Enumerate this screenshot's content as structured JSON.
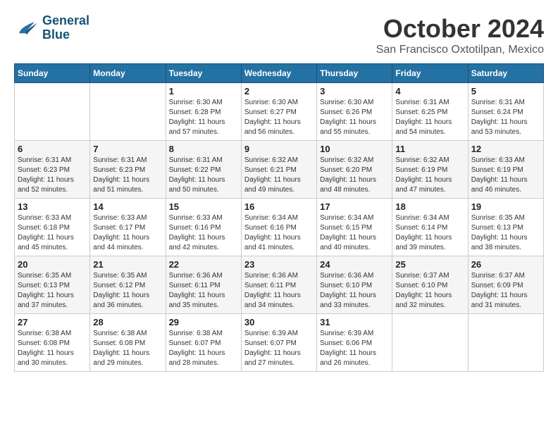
{
  "header": {
    "logo": {
      "line1": "General",
      "line2": "Blue"
    },
    "month": "October 2024",
    "location": "San Francisco Oxtotilpan, Mexico"
  },
  "days_of_week": [
    "Sunday",
    "Monday",
    "Tuesday",
    "Wednesday",
    "Thursday",
    "Friday",
    "Saturday"
  ],
  "weeks": [
    [
      {
        "day": "",
        "sunrise": "",
        "sunset": "",
        "daylight": ""
      },
      {
        "day": "",
        "sunrise": "",
        "sunset": "",
        "daylight": ""
      },
      {
        "day": "1",
        "sunrise": "Sunrise: 6:30 AM",
        "sunset": "Sunset: 6:28 PM",
        "daylight": "Daylight: 11 hours and 57 minutes."
      },
      {
        "day": "2",
        "sunrise": "Sunrise: 6:30 AM",
        "sunset": "Sunset: 6:27 PM",
        "daylight": "Daylight: 11 hours and 56 minutes."
      },
      {
        "day": "3",
        "sunrise": "Sunrise: 6:30 AM",
        "sunset": "Sunset: 6:26 PM",
        "daylight": "Daylight: 11 hours and 55 minutes."
      },
      {
        "day": "4",
        "sunrise": "Sunrise: 6:31 AM",
        "sunset": "Sunset: 6:25 PM",
        "daylight": "Daylight: 11 hours and 54 minutes."
      },
      {
        "day": "5",
        "sunrise": "Sunrise: 6:31 AM",
        "sunset": "Sunset: 6:24 PM",
        "daylight": "Daylight: 11 hours and 53 minutes."
      }
    ],
    [
      {
        "day": "6",
        "sunrise": "Sunrise: 6:31 AM",
        "sunset": "Sunset: 6:23 PM",
        "daylight": "Daylight: 11 hours and 52 minutes."
      },
      {
        "day": "7",
        "sunrise": "Sunrise: 6:31 AM",
        "sunset": "Sunset: 6:23 PM",
        "daylight": "Daylight: 11 hours and 51 minutes."
      },
      {
        "day": "8",
        "sunrise": "Sunrise: 6:31 AM",
        "sunset": "Sunset: 6:22 PM",
        "daylight": "Daylight: 11 hours and 50 minutes."
      },
      {
        "day": "9",
        "sunrise": "Sunrise: 6:32 AM",
        "sunset": "Sunset: 6:21 PM",
        "daylight": "Daylight: 11 hours and 49 minutes."
      },
      {
        "day": "10",
        "sunrise": "Sunrise: 6:32 AM",
        "sunset": "Sunset: 6:20 PM",
        "daylight": "Daylight: 11 hours and 48 minutes."
      },
      {
        "day": "11",
        "sunrise": "Sunrise: 6:32 AM",
        "sunset": "Sunset: 6:19 PM",
        "daylight": "Daylight: 11 hours and 47 minutes."
      },
      {
        "day": "12",
        "sunrise": "Sunrise: 6:33 AM",
        "sunset": "Sunset: 6:19 PM",
        "daylight": "Daylight: 11 hours and 46 minutes."
      }
    ],
    [
      {
        "day": "13",
        "sunrise": "Sunrise: 6:33 AM",
        "sunset": "Sunset: 6:18 PM",
        "daylight": "Daylight: 11 hours and 45 minutes."
      },
      {
        "day": "14",
        "sunrise": "Sunrise: 6:33 AM",
        "sunset": "Sunset: 6:17 PM",
        "daylight": "Daylight: 11 hours and 44 minutes."
      },
      {
        "day": "15",
        "sunrise": "Sunrise: 6:33 AM",
        "sunset": "Sunset: 6:16 PM",
        "daylight": "Daylight: 11 hours and 42 minutes."
      },
      {
        "day": "16",
        "sunrise": "Sunrise: 6:34 AM",
        "sunset": "Sunset: 6:16 PM",
        "daylight": "Daylight: 11 hours and 41 minutes."
      },
      {
        "day": "17",
        "sunrise": "Sunrise: 6:34 AM",
        "sunset": "Sunset: 6:15 PM",
        "daylight": "Daylight: 11 hours and 40 minutes."
      },
      {
        "day": "18",
        "sunrise": "Sunrise: 6:34 AM",
        "sunset": "Sunset: 6:14 PM",
        "daylight": "Daylight: 11 hours and 39 minutes."
      },
      {
        "day": "19",
        "sunrise": "Sunrise: 6:35 AM",
        "sunset": "Sunset: 6:13 PM",
        "daylight": "Daylight: 11 hours and 38 minutes."
      }
    ],
    [
      {
        "day": "20",
        "sunrise": "Sunrise: 6:35 AM",
        "sunset": "Sunset: 6:13 PM",
        "daylight": "Daylight: 11 hours and 37 minutes."
      },
      {
        "day": "21",
        "sunrise": "Sunrise: 6:35 AM",
        "sunset": "Sunset: 6:12 PM",
        "daylight": "Daylight: 11 hours and 36 minutes."
      },
      {
        "day": "22",
        "sunrise": "Sunrise: 6:36 AM",
        "sunset": "Sunset: 6:11 PM",
        "daylight": "Daylight: 11 hours and 35 minutes."
      },
      {
        "day": "23",
        "sunrise": "Sunrise: 6:36 AM",
        "sunset": "Sunset: 6:11 PM",
        "daylight": "Daylight: 11 hours and 34 minutes."
      },
      {
        "day": "24",
        "sunrise": "Sunrise: 6:36 AM",
        "sunset": "Sunset: 6:10 PM",
        "daylight": "Daylight: 11 hours and 33 minutes."
      },
      {
        "day": "25",
        "sunrise": "Sunrise: 6:37 AM",
        "sunset": "Sunset: 6:10 PM",
        "daylight": "Daylight: 11 hours and 32 minutes."
      },
      {
        "day": "26",
        "sunrise": "Sunrise: 6:37 AM",
        "sunset": "Sunset: 6:09 PM",
        "daylight": "Daylight: 11 hours and 31 minutes."
      }
    ],
    [
      {
        "day": "27",
        "sunrise": "Sunrise: 6:38 AM",
        "sunset": "Sunset: 6:08 PM",
        "daylight": "Daylight: 11 hours and 30 minutes."
      },
      {
        "day": "28",
        "sunrise": "Sunrise: 6:38 AM",
        "sunset": "Sunset: 6:08 PM",
        "daylight": "Daylight: 11 hours and 29 minutes."
      },
      {
        "day": "29",
        "sunrise": "Sunrise: 6:38 AM",
        "sunset": "Sunset: 6:07 PM",
        "daylight": "Daylight: 11 hours and 28 minutes."
      },
      {
        "day": "30",
        "sunrise": "Sunrise: 6:39 AM",
        "sunset": "Sunset: 6:07 PM",
        "daylight": "Daylight: 11 hours and 27 minutes."
      },
      {
        "day": "31",
        "sunrise": "Sunrise: 6:39 AM",
        "sunset": "Sunset: 6:06 PM",
        "daylight": "Daylight: 11 hours and 26 minutes."
      },
      {
        "day": "",
        "sunrise": "",
        "sunset": "",
        "daylight": ""
      },
      {
        "day": "",
        "sunrise": "",
        "sunset": "",
        "daylight": ""
      }
    ]
  ]
}
